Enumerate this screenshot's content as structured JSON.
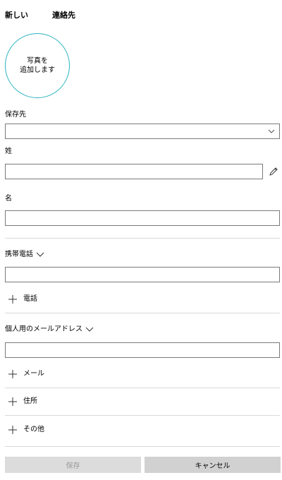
{
  "header": {
    "title_left": "新しい",
    "title_right": "連絡先"
  },
  "photo": {
    "label": "写真を\n追加します"
  },
  "save_location": {
    "label": "保存先",
    "value": ""
  },
  "last_name": {
    "label": "姓",
    "value": ""
  },
  "first_name": {
    "label": "名",
    "value": ""
  },
  "phone": {
    "type_label": "携帯電話",
    "value": "",
    "add_label": "電話"
  },
  "email": {
    "type_label": "個人用のメールアドレス",
    "value": "",
    "add_label": "メール"
  },
  "address": {
    "add_label": "住所"
  },
  "other": {
    "add_label": "その他"
  },
  "footer": {
    "save_label": "保存",
    "cancel_label": "キャンセル",
    "save_enabled": false
  },
  "colors": {
    "accent": "#2bb3c0",
    "border": "#7a7a7a",
    "divider": "#d9d9d9",
    "button_bg": "#d1d1d1"
  }
}
